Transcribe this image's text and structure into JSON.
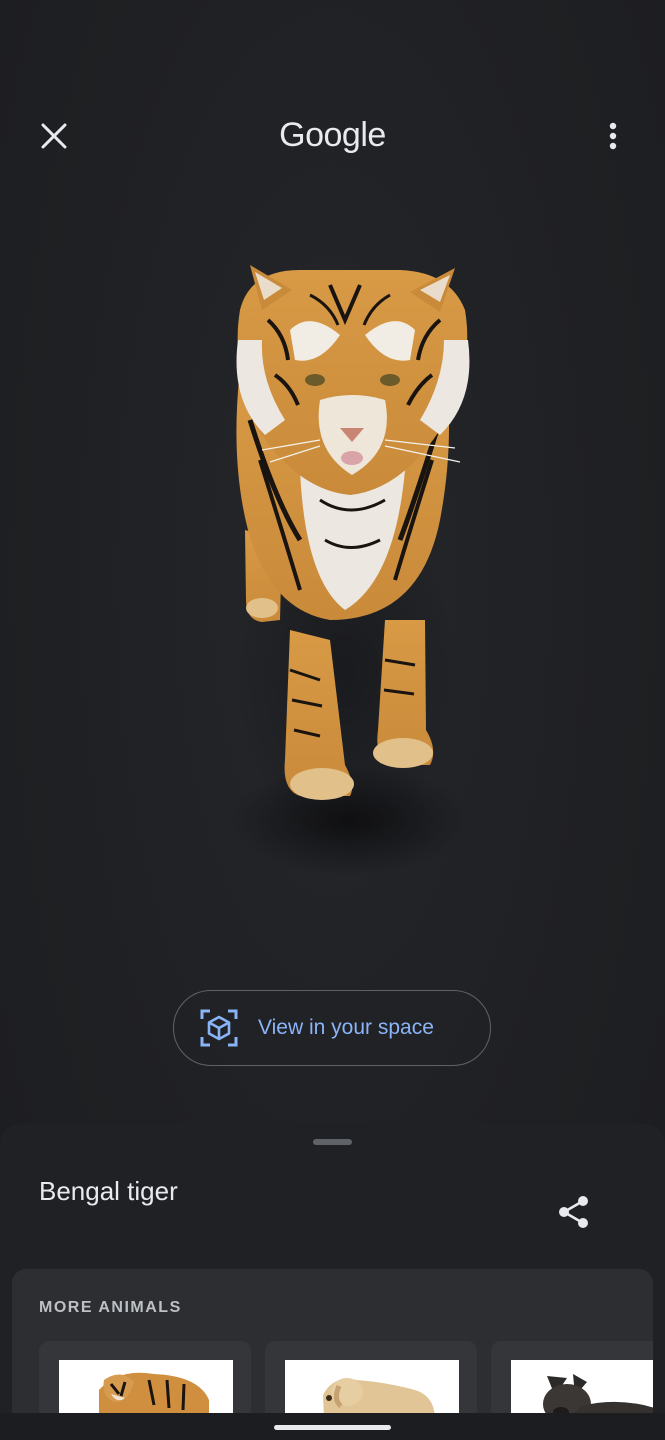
{
  "header": {
    "brand": "Google",
    "close_icon": "close-icon",
    "more_icon": "more-vert-icon"
  },
  "model": {
    "subject_icon": "tiger-3d-model"
  },
  "ar_button": {
    "label": "View in your space",
    "icon": "ar-cube-icon",
    "accent": "#8ab4f8"
  },
  "sheet": {
    "title": "Bengal tiger",
    "share_icon": "share-icon",
    "more_section": {
      "heading": "MORE ANIMALS",
      "items": [
        {
          "icon": "tiger-thumbnail"
        },
        {
          "icon": "labrador-thumbnail"
        },
        {
          "icon": "bulldog-thumbnail"
        }
      ]
    }
  },
  "colors": {
    "background": "#1f2023",
    "sheet": "#202124",
    "card": "#2d2e31",
    "text": "#e8eaed"
  }
}
